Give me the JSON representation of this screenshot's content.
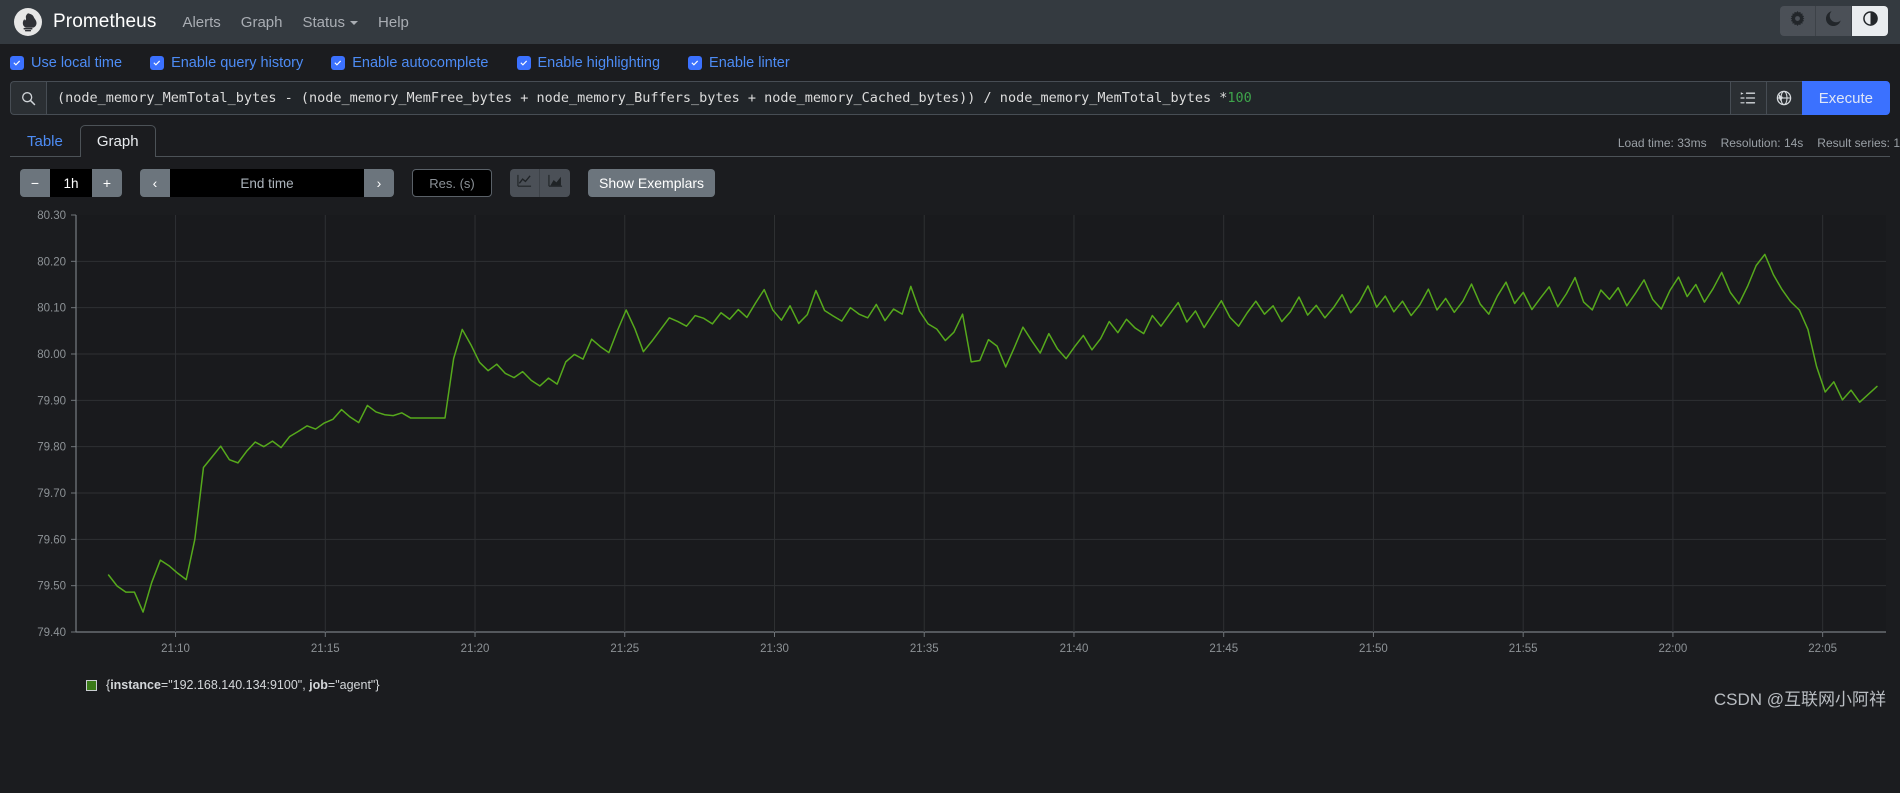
{
  "navbar": {
    "brand": "Prometheus",
    "logo_icon": "prometheus-torch-logo",
    "links": [
      {
        "label": "Alerts",
        "name": "alerts"
      },
      {
        "label": "Graph",
        "name": "graph"
      },
      {
        "label": "Status",
        "name": "status",
        "has_caret": true
      },
      {
        "label": "Help",
        "name": "help"
      }
    ],
    "theme_buttons": [
      {
        "icon": "sun-icon",
        "active": false
      },
      {
        "icon": "moon-icon",
        "active": false
      },
      {
        "icon": "contrast-auto-icon",
        "active": true
      }
    ]
  },
  "options": [
    {
      "label": "Use local time",
      "checked": true,
      "name": "use-local-time"
    },
    {
      "label": "Enable query history",
      "checked": true,
      "name": "enable-query-history"
    },
    {
      "label": "Enable autocomplete",
      "checked": true,
      "name": "enable-autocomplete"
    },
    {
      "label": "Enable highlighting",
      "checked": true,
      "name": "enable-highlighting"
    },
    {
      "label": "Enable linter",
      "checked": true,
      "name": "enable-linter"
    }
  ],
  "query": {
    "search_icon": "search-icon",
    "expression_head": "(node_memory_MemTotal_bytes - (node_memory_MemFree_bytes + node_memory_Buffers_bytes +  node_memory_Cached_bytes)) / node_memory_MemTotal_bytes * ",
    "expression_number": "100",
    "metrics_explorer_icon": "metrics-explorer-icon",
    "globe_icon": "globe-icon",
    "execute_label": "Execute"
  },
  "tabs": [
    {
      "label": "Table",
      "active": false,
      "name": "tab-table"
    },
    {
      "label": "Graph",
      "active": true,
      "name": "tab-graph"
    }
  ],
  "meta": {
    "load_time": "Load time: 33ms",
    "resolution": "Resolution: 14s",
    "result_series": "Result series: 1"
  },
  "controls": {
    "decrease_label": "−",
    "range_value": "1h",
    "increase_label": "+",
    "prev_label": "‹",
    "end_time_placeholder": "End time",
    "end_time_value": "",
    "next_label": "›",
    "resolution_placeholder": "Res. (s)",
    "resolution_value": "",
    "line_chart_icon": "line-chart-icon",
    "stacked_chart_icon": "stacked-area-chart-icon",
    "show_exemplars_label": "Show Exemplars"
  },
  "chart_data": {
    "type": "line",
    "title": "",
    "xlabel": "",
    "ylabel": "",
    "ylim": [
      79.4,
      80.3
    ],
    "yticks": [
      "79.40",
      "79.50",
      "79.60",
      "79.70",
      "79.80",
      "79.90",
      "80.00",
      "80.10",
      "80.20",
      "80.30"
    ],
    "xticks": [
      "21:10",
      "21:15",
      "21:20",
      "21:25",
      "21:30",
      "21:35",
      "21:40",
      "21:45",
      "21:50",
      "21:55",
      "22:00",
      "22:05"
    ],
    "grid": true,
    "legend_position": "bottom-left",
    "series": [
      {
        "name": "{instance=\"192.168.140.134:9100\", job=\"agent\"}",
        "color": "#56a91c",
        "values": [
          79.523,
          79.499,
          79.486,
          79.486,
          79.443,
          79.507,
          79.555,
          79.543,
          79.527,
          79.513,
          79.6,
          79.755,
          79.778,
          79.801,
          79.772,
          79.765,
          79.79,
          79.81,
          79.8,
          79.812,
          79.798,
          79.822,
          79.833,
          79.845,
          79.838,
          79.851,
          79.859,
          79.88,
          79.864,
          79.852,
          79.889,
          79.875,
          79.869,
          79.867,
          79.873,
          79.862,
          79.862,
          79.862,
          79.862,
          79.862,
          79.99,
          80.053,
          80.02,
          79.982,
          79.964,
          79.978,
          79.958,
          79.949,
          79.962,
          79.943,
          79.931,
          79.948,
          79.935,
          79.983,
          79.999,
          79.989,
          80.032,
          80.016,
          80.003,
          80.051,
          80.095,
          80.055,
          80.005,
          80.028,
          80.053,
          80.078,
          80.07,
          80.06,
          80.083,
          80.077,
          80.065,
          80.089,
          80.075,
          80.096,
          80.079,
          80.11,
          80.139,
          80.095,
          80.073,
          80.104,
          80.066,
          80.085,
          80.137,
          80.094,
          80.082,
          80.071,
          80.1,
          80.086,
          80.078,
          80.107,
          80.072,
          80.097,
          80.086,
          80.146,
          80.093,
          80.065,
          80.054,
          80.029,
          80.047,
          80.086,
          79.983,
          79.986,
          80.031,
          80.017,
          79.972,
          80.014,
          80.058,
          80.029,
          80.002,
          80.044,
          80.011,
          79.99,
          80.016,
          80.04,
          80.009,
          80.033,
          80.07,
          80.046,
          80.075,
          80.056,
          80.044,
          80.083,
          80.06,
          80.086,
          80.111,
          80.069,
          80.093,
          80.057,
          80.086,
          80.115,
          80.079,
          80.06,
          80.089,
          80.114,
          80.086,
          80.104,
          80.07,
          80.091,
          80.123,
          80.084,
          80.105,
          80.078,
          80.1,
          80.128,
          80.089,
          80.112,
          80.147,
          80.101,
          80.125,
          80.091,
          80.114,
          80.083,
          80.106,
          80.14,
          80.095,
          80.12,
          80.09,
          80.114,
          80.151,
          80.108,
          80.086,
          80.125,
          80.155,
          80.109,
          80.133,
          80.096,
          80.121,
          80.145,
          80.102,
          80.13,
          80.165,
          80.112,
          80.095,
          80.138,
          80.118,
          80.143,
          80.104,
          80.131,
          80.16,
          80.118,
          80.097,
          80.137,
          80.166,
          80.124,
          80.15,
          80.112,
          80.141,
          80.176,
          80.133,
          80.108,
          80.146,
          80.191,
          80.215,
          80.171,
          80.139,
          80.113,
          80.095,
          80.053,
          79.973,
          79.918,
          79.94,
          79.901,
          79.922,
          79.896,
          79.913,
          79.93
        ]
      }
    ]
  },
  "legend": {
    "swatch_color": "#3a7a18",
    "prefix": "{",
    "label_instance": "instance",
    "value_instance": "=\"192.168.140.134\", ",
    "text_full": "{instance=\"192.168.140.134:9100\", job=\"agent\"}"
  },
  "watermark": "CSDN @互联网小阿祥"
}
